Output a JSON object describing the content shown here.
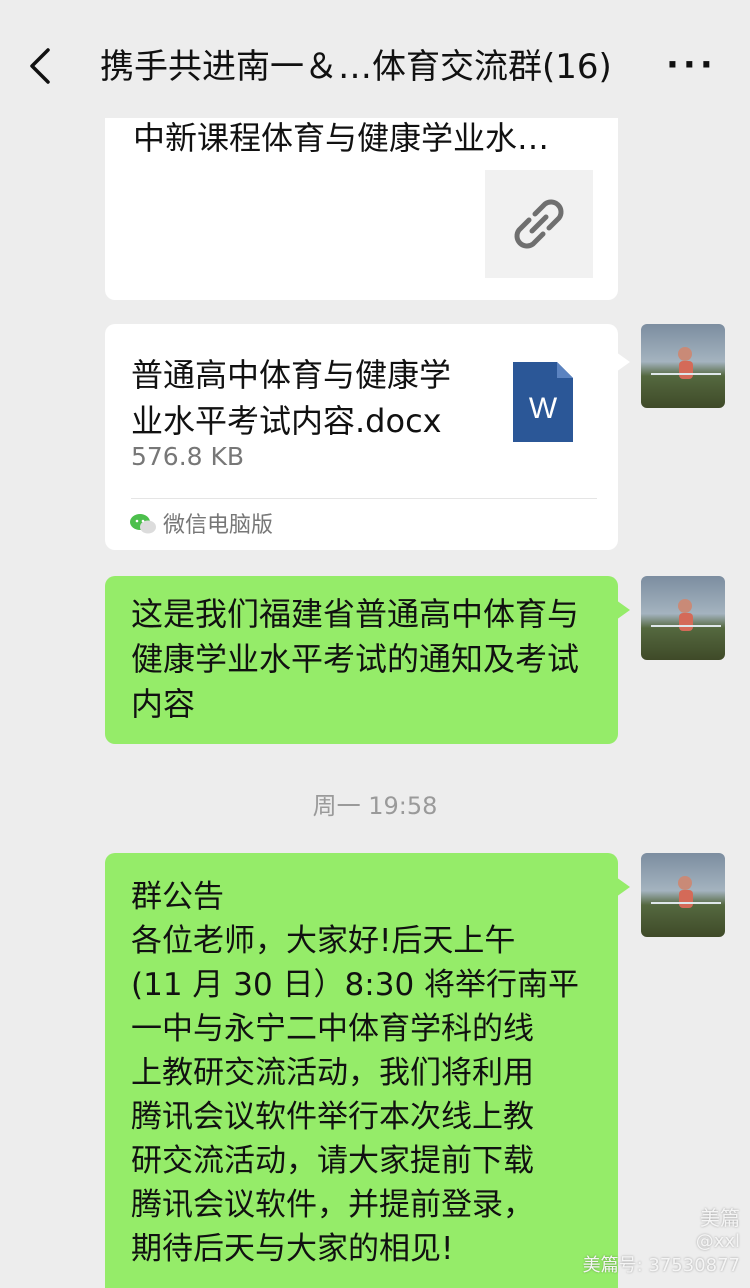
{
  "header": {
    "title": "携手共进南一＆…体育交流群(16)",
    "more_label": "···"
  },
  "messages": {
    "link_card": {
      "title": "中新课程体育与健康学业水…",
      "thumb_icon": "link-icon"
    },
    "file_card": {
      "file_name": "普通高中体育与健康学业水平考试内容.docx",
      "file_size": "576.8 KB",
      "file_icon_letter": "W",
      "source": "微信电脑版"
    },
    "text_message_1": "这是我们福建省普通高中体育与健康学业水平考试的通知及考试内容",
    "timestamp": "周一 19:58",
    "announcement": {
      "heading": "群公告",
      "lines": [
        "各位老师，大家好!后天上午",
        "(11 月 30 日）8:30 将举行南平",
        "一中与永宁二中体育学科的线",
        "上教研交流活动，我们将利用",
        "腾讯会议软件举行本次线上教",
        "研交流活动，请大家提前下载",
        "腾讯会议软件，并提前登录，",
        "期待后天与大家的相见!"
      ]
    }
  },
  "watermark": {
    "logo": "美篇",
    "user": "@xxl",
    "id": "美篇号: 37530877"
  },
  "colors": {
    "background": "#ededed",
    "green_bubble": "#95ec69",
    "word_blue": "#2b5797"
  }
}
